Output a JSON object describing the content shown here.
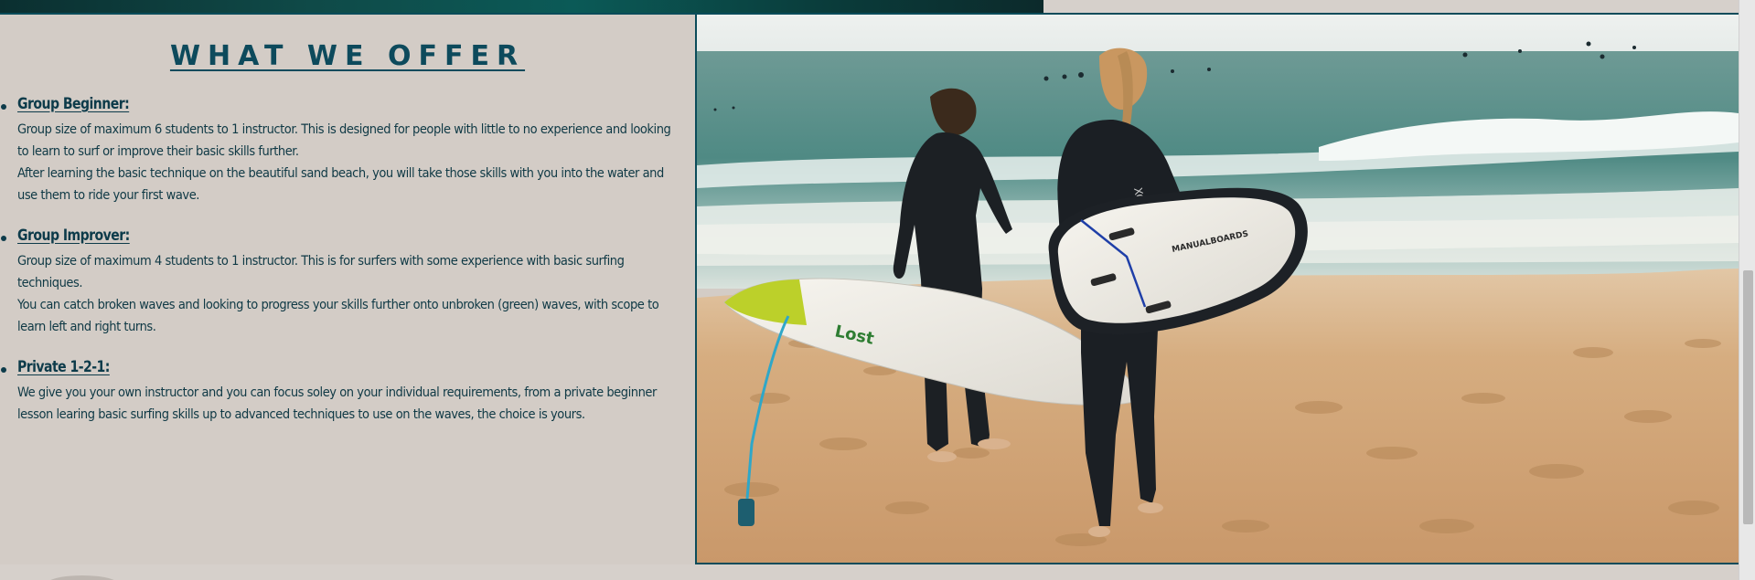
{
  "offer": {
    "title": "WHAT WE OFFER",
    "items": [
      {
        "title": "Group Beginner:",
        "lines": [
          "Group size of maximum 6 students to 1 instructor. This is designed for people with little to no experience and looking to learn to surf or improve their basic skills further.",
          "After learning the basic technique on the beautiful sand beach, you will take those skills with you into the water and use them to ride your first wave."
        ]
      },
      {
        "title": "Group Improver:",
        "lines": [
          "Group size of maximum 4 students to 1 instructor. This is for surfers with some experience with basic surfing techniques.",
          "You can catch broken waves and looking to progress your skills further onto unbroken (green) waves, with scope to learn left and right turns."
        ]
      },
      {
        "title": "Private 1-2-1:",
        "lines": [
          "We give you your own instructor and you can focus soley on your individual requirements, from a private beginner lesson learing basic surfing skills up to advanced techniques to use on the waves, the choice is yours."
        ]
      }
    ]
  },
  "photo": {
    "board_brand_text": "MANUALBOARDS",
    "wetsuit_text": "XCEL",
    "board_logo_text": "Lost"
  },
  "colors": {
    "accent": "#0d4a5c",
    "background": "#d3ccc6",
    "border": "#0b4c5a"
  }
}
